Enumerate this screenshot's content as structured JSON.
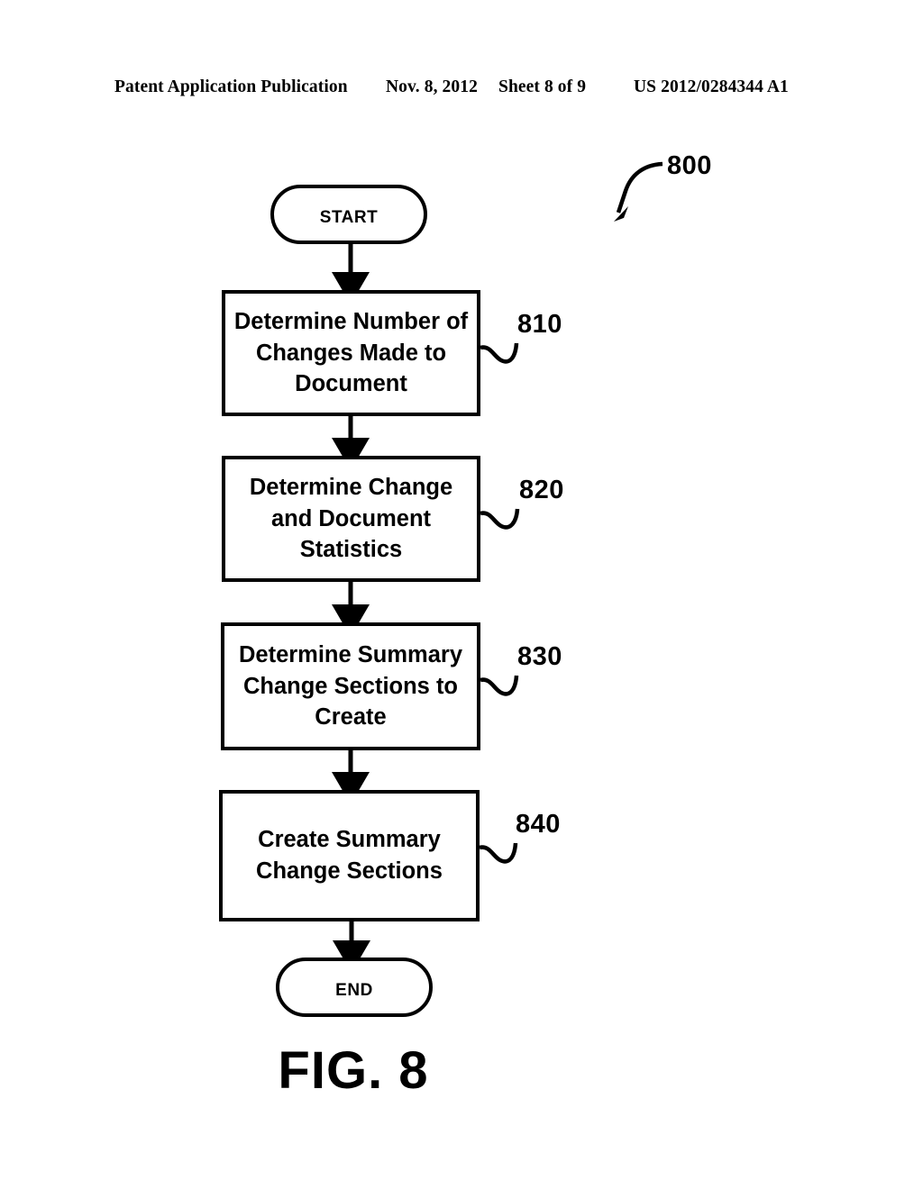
{
  "header": {
    "publication": "Patent Application Publication",
    "date": "Nov. 8, 2012",
    "sheet": "Sheet 8 of 9",
    "patent_number": "US 2012/0284344 A1"
  },
  "figure": {
    "caption": "FIG. 8",
    "diagram_reference": "800"
  },
  "flowchart": {
    "start_label": "Start",
    "end_label": "End",
    "steps": [
      {
        "ref": "810",
        "text": "Determine Number of Changes Made to Document"
      },
      {
        "ref": "820",
        "text": "Determine Change and Document Statistics"
      },
      {
        "ref": "830",
        "text": "Determine Summary Change Sections to Create"
      },
      {
        "ref": "840",
        "text": "Create Summary Change Sections"
      }
    ]
  },
  "style": {
    "ink": "#000000",
    "paper": "#ffffff"
  }
}
